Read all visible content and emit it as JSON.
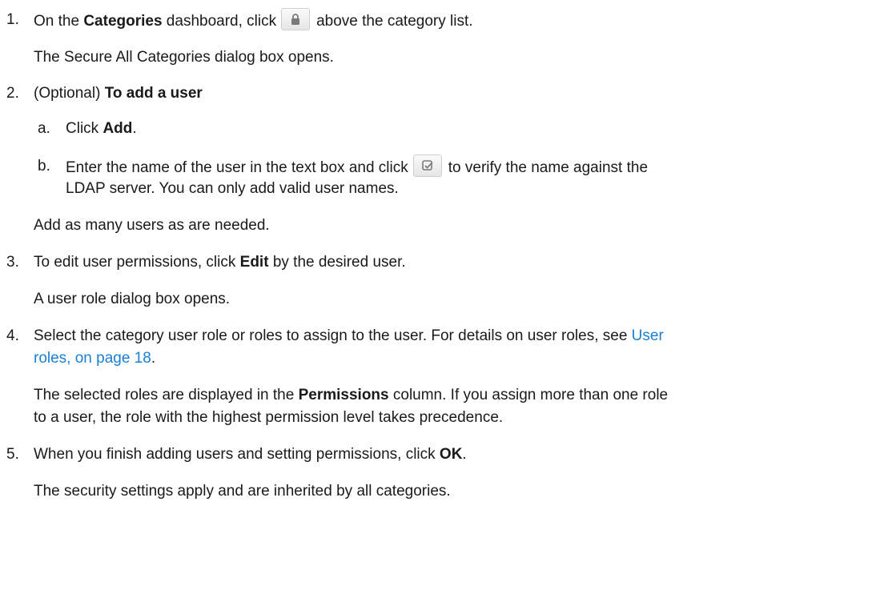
{
  "steps": [
    {
      "num": "1.",
      "pre": "On the ",
      "bold": "Categories",
      "mid": " dashboard, click",
      "post": "above the category list.",
      "icon": "lock-icon",
      "result": "The Secure All Categories dialog box opens."
    },
    {
      "num": "2.",
      "pre": "(Optional) ",
      "bold": "To add a user",
      "substeps": [
        {
          "letter": "a.",
          "pre": "Click ",
          "bold": "Add",
          "post": "."
        },
        {
          "letter": "b.",
          "pre": "Enter the name of the user in the text box and click",
          "post": "to verify the name against the",
          "line2": "LDAP server. You can only add valid user names.",
          "icon": "verify-check-icon"
        }
      ],
      "result": "Add as many users as are needed."
    },
    {
      "num": "3.",
      "pre": "To edit user permissions, click ",
      "bold": "Edit",
      "post": " by the desired user.",
      "result": "A user role dialog box opens."
    },
    {
      "num": "4.",
      "pre": "Select the category user role or roles to assign to the user. For details on user roles, see ",
      "link1": "User",
      "link2": "roles, on page 18",
      "post": ".",
      "result_pre": "The selected roles are displayed in the ",
      "result_bold": "Permissions",
      "result_post": " column. If you assign more than one role",
      "result_line2": "to a user, the role with the highest permission level takes precedence."
    },
    {
      "num": "5.",
      "pre": "When you finish adding users and setting permissions, click ",
      "bold": "OK",
      "post": ".",
      "result": "The security settings apply and are inherited by all categories."
    }
  ],
  "colors": {
    "text": "#1a1a1a",
    "link": "#1a7fd6",
    "icon": "#7a7a7a"
  }
}
